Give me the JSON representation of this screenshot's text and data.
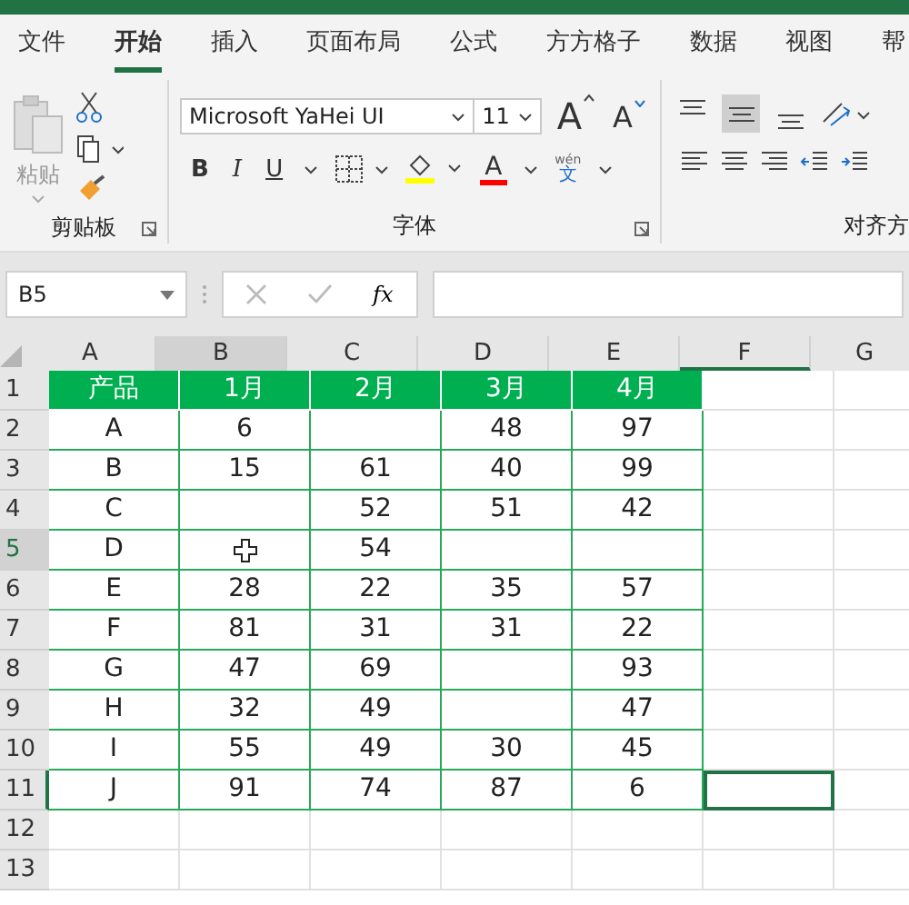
{
  "menu_tabs": [
    {
      "label": "文件",
      "selected": false
    },
    {
      "label": "开始",
      "selected": true
    },
    {
      "label": "插入",
      "selected": false
    },
    {
      "label": "页面布局",
      "selected": false
    },
    {
      "label": "公式",
      "selected": false
    },
    {
      "label": "方方格子",
      "selected": false
    },
    {
      "label": "数据",
      "selected": false
    },
    {
      "label": "视图",
      "selected": false
    },
    {
      "label": "帮",
      "selected": false
    }
  ],
  "ribbon": {
    "paste_label": "粘贴",
    "clipboard_label": "剪贴板",
    "font_name": "Microsoft YaHei UI",
    "font_size": "11",
    "font_label": "字体",
    "grow_label": "A",
    "shrink_label": "A",
    "bold_label": "B",
    "italic_label": "I",
    "underline_label": "U",
    "font_color_label": "A",
    "phonetic_top": "wén",
    "phonetic_bottom": "文",
    "align_label": "对齐方",
    "align_buttons": [
      {
        "kind": "top",
        "selected": false
      },
      {
        "kind": "middle",
        "selected": true
      },
      {
        "kind": "bottom",
        "selected": false
      }
    ]
  },
  "formula_bar": {
    "name_box": "B5",
    "fx": "fx"
  },
  "columns": [
    {
      "label": "A",
      "selected": false,
      "active": false
    },
    {
      "label": "B",
      "selected": true,
      "active": false
    },
    {
      "label": "C",
      "selected": false,
      "active": false
    },
    {
      "label": "D",
      "selected": false,
      "active": false
    },
    {
      "label": "E",
      "selected": false,
      "active": false
    },
    {
      "label": "F",
      "selected": false,
      "active": true
    },
    {
      "label": "G",
      "selected": false,
      "active": false
    }
  ],
  "rows": [
    {
      "label": "1",
      "selected": false,
      "active": false,
      "cells": [
        "产品",
        "1月",
        "2月",
        "3月",
        "4月"
      ]
    },
    {
      "label": "2",
      "selected": false,
      "active": false,
      "cells": [
        "A",
        "6",
        "",
        "48",
        "97"
      ]
    },
    {
      "label": "3",
      "selected": false,
      "active": false,
      "cells": [
        "B",
        "15",
        "61",
        "40",
        "99"
      ]
    },
    {
      "label": "4",
      "selected": false,
      "active": false,
      "cells": [
        "C",
        "",
        "52",
        "51",
        "42"
      ]
    },
    {
      "label": "5",
      "selected": true,
      "active": false,
      "cells": [
        "D",
        "",
        "54",
        "",
        ""
      ]
    },
    {
      "label": "6",
      "selected": false,
      "active": false,
      "cells": [
        "E",
        "28",
        "22",
        "35",
        "57"
      ]
    },
    {
      "label": "7",
      "selected": false,
      "active": false,
      "cells": [
        "F",
        "81",
        "31",
        "31",
        "22"
      ]
    },
    {
      "label": "8",
      "selected": false,
      "active": false,
      "cells": [
        "G",
        "47",
        "69",
        "",
        "93"
      ]
    },
    {
      "label": "9",
      "selected": false,
      "active": false,
      "cells": [
        "H",
        "32",
        "49",
        "",
        "47"
      ]
    },
    {
      "label": "10",
      "selected": false,
      "active": false,
      "cells": [
        "I",
        "55",
        "49",
        "30",
        "45"
      ]
    },
    {
      "label": "11",
      "selected": false,
      "active": true,
      "cells": [
        "J",
        "91",
        "74",
        "87",
        "6"
      ]
    },
    {
      "label": "12",
      "selected": false,
      "active": false,
      "cells": []
    },
    {
      "label": "13",
      "selected": false,
      "active": false,
      "cells": []
    }
  ]
}
